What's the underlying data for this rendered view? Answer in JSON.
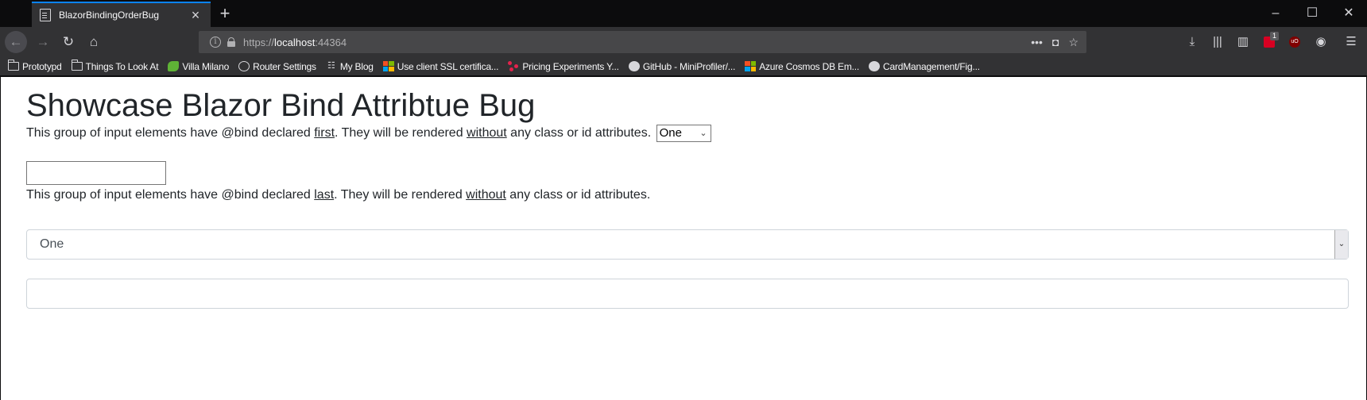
{
  "browser": {
    "tab_title": "BlazorBindingOrderBug",
    "url_scheme": "https://",
    "url_host": "localhost",
    "url_port": ":44364",
    "extension_badge": "1",
    "ublock_label": "uO"
  },
  "bookmarks": [
    {
      "label": "Prototypd",
      "icon": "folder-icon"
    },
    {
      "label": "Things To Look At",
      "icon": "folder-icon"
    },
    {
      "label": "Villa Milano",
      "icon": "leaf-icon"
    },
    {
      "label": "Router Settings",
      "icon": "globe-icon"
    },
    {
      "label": "My Blog",
      "icon": "blog-icon"
    },
    {
      "label": "Use client SSL certifica...",
      "icon": "microsoft-icon"
    },
    {
      "label": "Pricing Experiments Y...",
      "icon": "dots-icon"
    },
    {
      "label": "GitHub - MiniProfiler/...",
      "icon": "github-icon"
    },
    {
      "label": "Azure Cosmos DB Em...",
      "icon": "microsoft-icon"
    },
    {
      "label": "CardManagement/Fig...",
      "icon": "github-icon"
    }
  ],
  "page": {
    "title": "Showcase Blazor Bind Attribtue Bug",
    "group1": {
      "pre": "This group of input elements have @bind declared ",
      "emph": "first",
      "mid": ". They will be rendered ",
      "emph2": "without",
      "post": " any class or id attributes.",
      "select_value": "One",
      "input_value": ""
    },
    "group2": {
      "pre": "This group of input elements have @bind declared ",
      "emph": "last",
      "mid": ". They will be rendered ",
      "emph2": "without",
      "post": " any class or id attributes.",
      "select_value": "One",
      "input_value": ""
    }
  },
  "colors": {
    "tab_accent": "#0a84ff",
    "chrome_bg": "#323234",
    "titlebar_bg": "#0c0c0d",
    "page_text": "#212529"
  }
}
